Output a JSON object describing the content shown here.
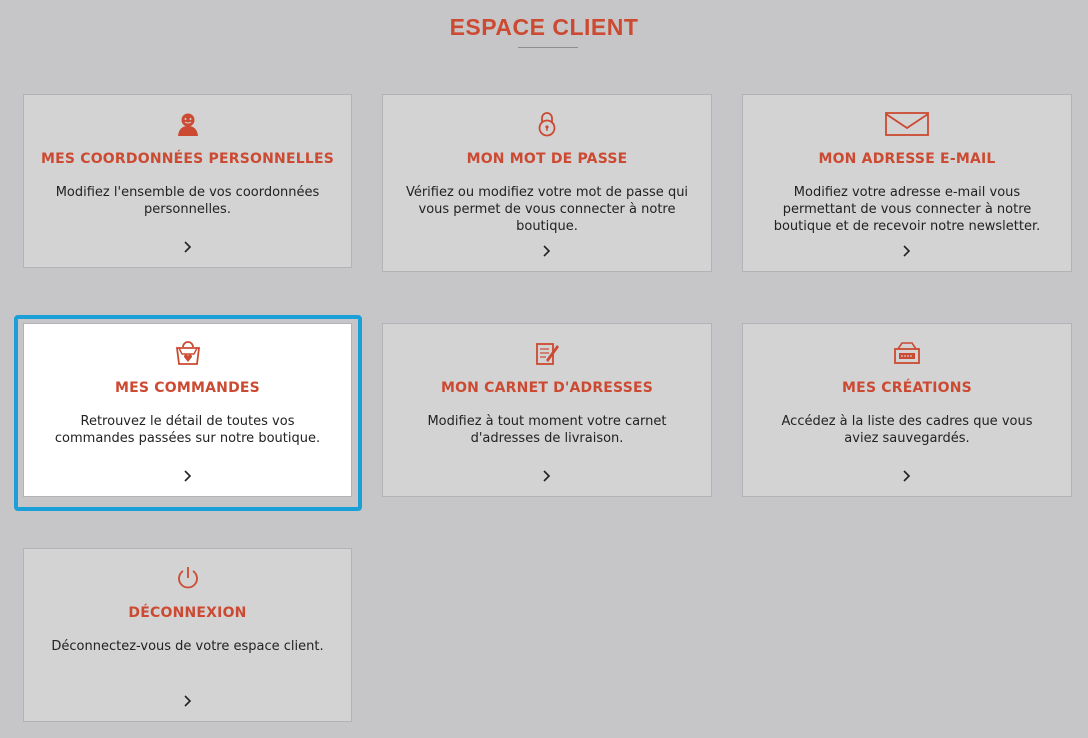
{
  "page": {
    "title": "ESPACE CLIENT"
  },
  "colors": {
    "accent": "#cc4a31",
    "focus": "#1a9fd8",
    "card_bg": "#d3d3d3",
    "page_bg": "#c6c6c8"
  },
  "cards": [
    {
      "id": "coordonnees",
      "icon": "person-icon",
      "title": "MES COORDONNÉES PERSONNELLES",
      "description": "Modifiez l'ensemble de vos coordonnées personnelles."
    },
    {
      "id": "mot-de-passe",
      "icon": "padlock-icon",
      "title": "MON MOT DE PASSE",
      "description": "Vérifiez ou modifiez votre mot de passe qui vous permet de vous connecter à notre boutique."
    },
    {
      "id": "email",
      "icon": "envelope-icon",
      "title": "MON ADRESSE E-MAIL",
      "description": "Modifiez votre adresse e-mail vous permettant de vous connecter à notre boutique et de recevoir notre newsletter."
    },
    {
      "id": "commandes",
      "icon": "shopping-bag-icon",
      "title": "MES COMMANDES",
      "description": "Retrouvez le détail de toutes vos commandes passées sur notre boutique.",
      "selected": true
    },
    {
      "id": "carnet",
      "icon": "notepad-pencil-icon",
      "title": "MON CARNET D'ADRESSES",
      "description": "Modifiez à tout moment votre carnet d'adresses de livraison."
    },
    {
      "id": "creations",
      "icon": "frame-box-icon",
      "title": "MES CRÉATIONS",
      "description": "Accédez à la liste des cadres que vous aviez sauvegardés."
    },
    {
      "id": "deconnexion",
      "icon": "power-icon",
      "title": "DÉCONNEXION",
      "description": "Déconnectez-vous de votre espace client."
    }
  ]
}
